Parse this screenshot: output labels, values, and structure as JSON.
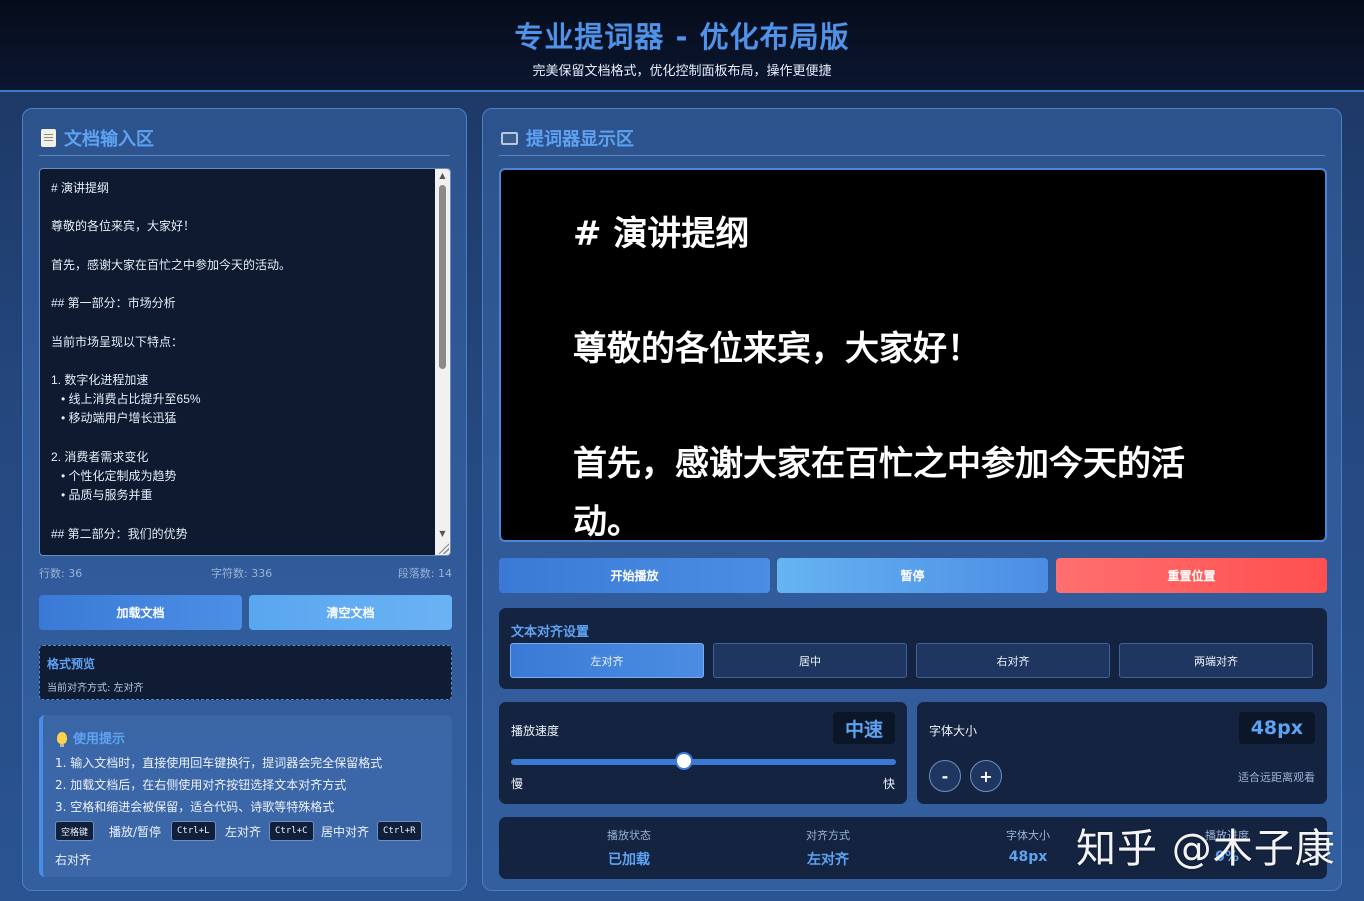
{
  "header": {
    "title": "专业提词器 - 优化布局版",
    "subtitle": "完美保留文档格式，优化控制面板布局，操作更便捷"
  },
  "input_panel": {
    "title": "文档输入区",
    "editor_text": "# 演讲提纲\n\n尊敬的各位来宾，大家好！\n\n首先，感谢大家在百忙之中参加今天的活动。\n\n## 第一部分：市场分析\n\n当前市场呈现以下特点：\n\n1. 数字化进程加速\n   • 线上消费占比提升至65%\n   • 移动端用户增长迅猛\n\n2. 消费者需求变化\n   • 个性化定制成为趋势\n   • 品质与服务并重\n\n## 第二部分：我们的优势",
    "stats": {
      "lines": "行数: 36",
      "chars": "字符数: 336",
      "paragraphs": "段落数: 14"
    },
    "load_button": "加载文档",
    "clear_button": "清空文档",
    "preview": {
      "title": "格式预览",
      "text": "当前对齐方式: 左对齐"
    },
    "tips": {
      "title": "使用提示",
      "items": [
        "1. 输入文档时，直接使用回车键换行，提词器会完全保留格式",
        "2. 加载文档后，在右侧使用对齐按钮选择文本对齐方式",
        "3. 空格和缩进会被保留，适合代码、诗歌等特殊格式"
      ],
      "shortcuts": [
        {
          "key": "空格键",
          "action": "播放/暂停"
        },
        {
          "key": "Ctrl+L",
          "action": "左对齐"
        },
        {
          "key": "Ctrl+C",
          "action": "居中对齐"
        },
        {
          "key": "Ctrl+R",
          "action": "右对齐"
        }
      ]
    }
  },
  "display_panel": {
    "title": "提词器显示区",
    "lines": [
      "# 演讲提纲",
      "",
      "尊敬的各位来宾，大家好！",
      "",
      "首先，感谢大家在百忙之中参加今天的活",
      "动。"
    ],
    "play_button": "开始播放",
    "pause_button": "暂停",
    "reset_button": "重置位置"
  },
  "align_settings": {
    "title": "文本对齐设置",
    "options": [
      "左对齐",
      "居中",
      "右对齐",
      "两端对齐"
    ],
    "selected": "左对齐"
  },
  "speed": {
    "label": "播放速度",
    "value": "中速",
    "slow": "慢",
    "fast": "快",
    "level": 0.45
  },
  "font_size": {
    "label": "字体大小",
    "value": "48px",
    "decrease": "-",
    "increase": "+",
    "hint": "适合远距离观看"
  },
  "status": [
    {
      "label": "播放状态",
      "value": "已加载"
    },
    {
      "label": "对齐方式",
      "value": "左对齐"
    },
    {
      "label": "字体大小",
      "value": "48px"
    },
    {
      "label": "播放进度",
      "value": "0%"
    }
  ],
  "watermark": "知乎 @木子康",
  "colors": {
    "accent": "#5ea2f2",
    "play": "#3a7ad6",
    "pause": "#66b4f2",
    "reset": "#ff4f4f"
  }
}
